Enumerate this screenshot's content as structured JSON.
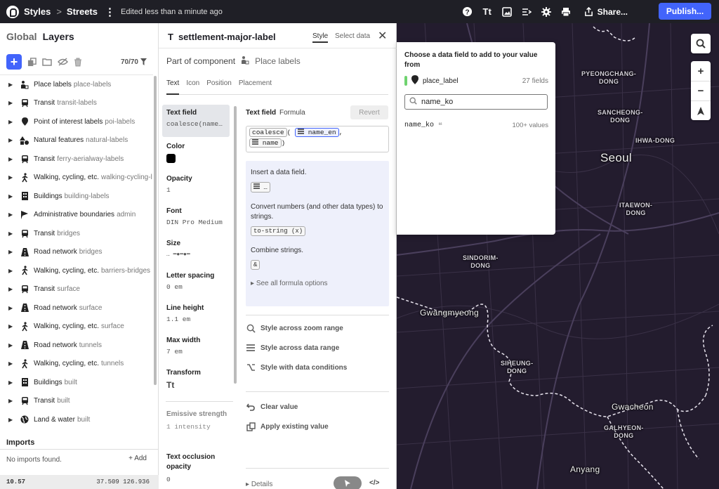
{
  "topbar": {
    "breadcrumb_styles": "Styles",
    "breadcrumb_sep": ">",
    "breadcrumb_style": "Streets",
    "edited": "Edited less than a minute ago",
    "share": "Share...",
    "publish": "Publish..."
  },
  "left": {
    "tab_global": "Global",
    "tab_layers": "Layers",
    "count": "70/70",
    "layers": [
      {
        "name": "Place labels",
        "sub": "place-labels",
        "icon": "people-icon"
      },
      {
        "name": "Transit",
        "sub": "transit-labels",
        "icon": "train-icon"
      },
      {
        "name": "Point of interest labels",
        "sub": "poi-labels",
        "icon": "pin-icon"
      },
      {
        "name": "Natural features",
        "sub": "natural-labels",
        "icon": "shapes-icon"
      },
      {
        "name": "Transit",
        "sub": "ferry-aerialway-labels",
        "icon": "train-icon"
      },
      {
        "name": "Walking, cycling, etc.",
        "sub": "walking-cycling-l",
        "icon": "walker-icon"
      },
      {
        "name": "Buildings",
        "sub": "building-labels",
        "icon": "building-icon"
      },
      {
        "name": "Administrative boundaries",
        "sub": "admin",
        "icon": "flag-icon"
      },
      {
        "name": "Transit",
        "sub": "bridges",
        "icon": "train-icon"
      },
      {
        "name": "Road network",
        "sub": "bridges",
        "icon": "road-icon"
      },
      {
        "name": "Walking, cycling, etc.",
        "sub": "barriers-bridges",
        "icon": "walker-icon"
      },
      {
        "name": "Transit",
        "sub": "surface",
        "icon": "train-icon"
      },
      {
        "name": "Road network",
        "sub": "surface",
        "icon": "road-icon"
      },
      {
        "name": "Walking, cycling, etc.",
        "sub": "surface",
        "icon": "walker-icon"
      },
      {
        "name": "Road network",
        "sub": "tunnels",
        "icon": "road-icon"
      },
      {
        "name": "Walking, cycling, etc.",
        "sub": "tunnels",
        "icon": "walker-icon"
      },
      {
        "name": "Buildings",
        "sub": "built",
        "icon": "building-icon"
      },
      {
        "name": "Transit",
        "sub": "built",
        "icon": "train-icon"
      },
      {
        "name": "Land & water",
        "sub": "built",
        "icon": "globe-icon"
      }
    ],
    "imports_title": "Imports",
    "no_imports": "No imports found.",
    "add": "Add",
    "zoom": "10.57",
    "coords": "37.509 126.936"
  },
  "mid": {
    "layer_title": "settlement-major-label",
    "tab_style": "Style",
    "tab_select_data": "Select data",
    "component_label": "Part of component",
    "component_value": "Place labels",
    "subtabs": [
      "Text",
      "Icon",
      "Position",
      "Placement"
    ],
    "props": {
      "text_field": {
        "label": "Text field",
        "value": "coalesce(name…"
      },
      "color": {
        "label": "Color",
        "value": "#000000"
      },
      "opacity": {
        "label": "Opacity",
        "value": "1"
      },
      "font": {
        "label": "Font",
        "value": "DIN Pro Medium"
      },
      "size": {
        "label": "Size",
        "value": "… ━●━●━"
      },
      "letter_spacing": {
        "label": "Letter spacing",
        "value": "0 em"
      },
      "line_height": {
        "label": "Line height",
        "value": "1.1 em"
      },
      "max_width": {
        "label": "Max width",
        "value": "7 em"
      },
      "transform": {
        "label": "Transform",
        "value": "Tt"
      },
      "emissive": {
        "label": "Emissive strength",
        "value": "1 intensity"
      },
      "occlusion": {
        "label": "Text occlusion opacity",
        "value": "0"
      }
    },
    "editor": {
      "label": "Text field",
      "formula": "Formula",
      "revert": "Revert",
      "expr_fn": "coalesce",
      "expr_open": "(",
      "expr_field1": "name_en",
      "expr_comma": ",",
      "expr_field2": "name",
      "expr_close": ")",
      "help_insert": "Insert a data field.",
      "help_insert_chip": "…",
      "help_convert": "Convert numbers (and other data types) to strings.",
      "help_convert_chip": "to-string (x)",
      "help_combine": "Combine strings.",
      "help_combine_chip": "&",
      "see_all": "See all formula options",
      "style_zoom": "Style across zoom range",
      "style_data": "Style across data range",
      "style_conditions": "Style with data conditions",
      "clear": "Clear value",
      "apply": "Apply existing value",
      "details": "Details"
    }
  },
  "popup": {
    "title": "Choose a data field to add to your value from",
    "source_name": "place_label",
    "source_count": "27 fields",
    "search_value": "name_ko",
    "result_name": "name_ko",
    "result_quote": "❝",
    "result_count": "100+ values",
    "source_color": "#6fd36f"
  },
  "map": {
    "labels": [
      {
        "text": "PYEONGCHANG-\nDONG",
        "cls": ""
      },
      {
        "text": "SANCHEONG-\nDONG",
        "cls": ""
      },
      {
        "text": "IHWA-DONG",
        "cls": ""
      },
      {
        "text": "Seoul",
        "cls": "big"
      },
      {
        "text": "ITAEWON-\nDONG",
        "cls": ""
      },
      {
        "text": "SINDORIM-\nDONG",
        "cls": ""
      },
      {
        "text": "Gwangmyeong",
        "cls": "med"
      },
      {
        "text": "SIHEUNG-\nDONG",
        "cls": ""
      },
      {
        "text": "Gwacheon",
        "cls": "med"
      },
      {
        "text": "GALHYEON-\nDONG",
        "cls": ""
      },
      {
        "text": "Anyang",
        "cls": "med"
      }
    ]
  },
  "colors": {
    "accent": "#4264fb",
    "topbar": "#1f1f26",
    "map_bg": "#231c2e"
  }
}
